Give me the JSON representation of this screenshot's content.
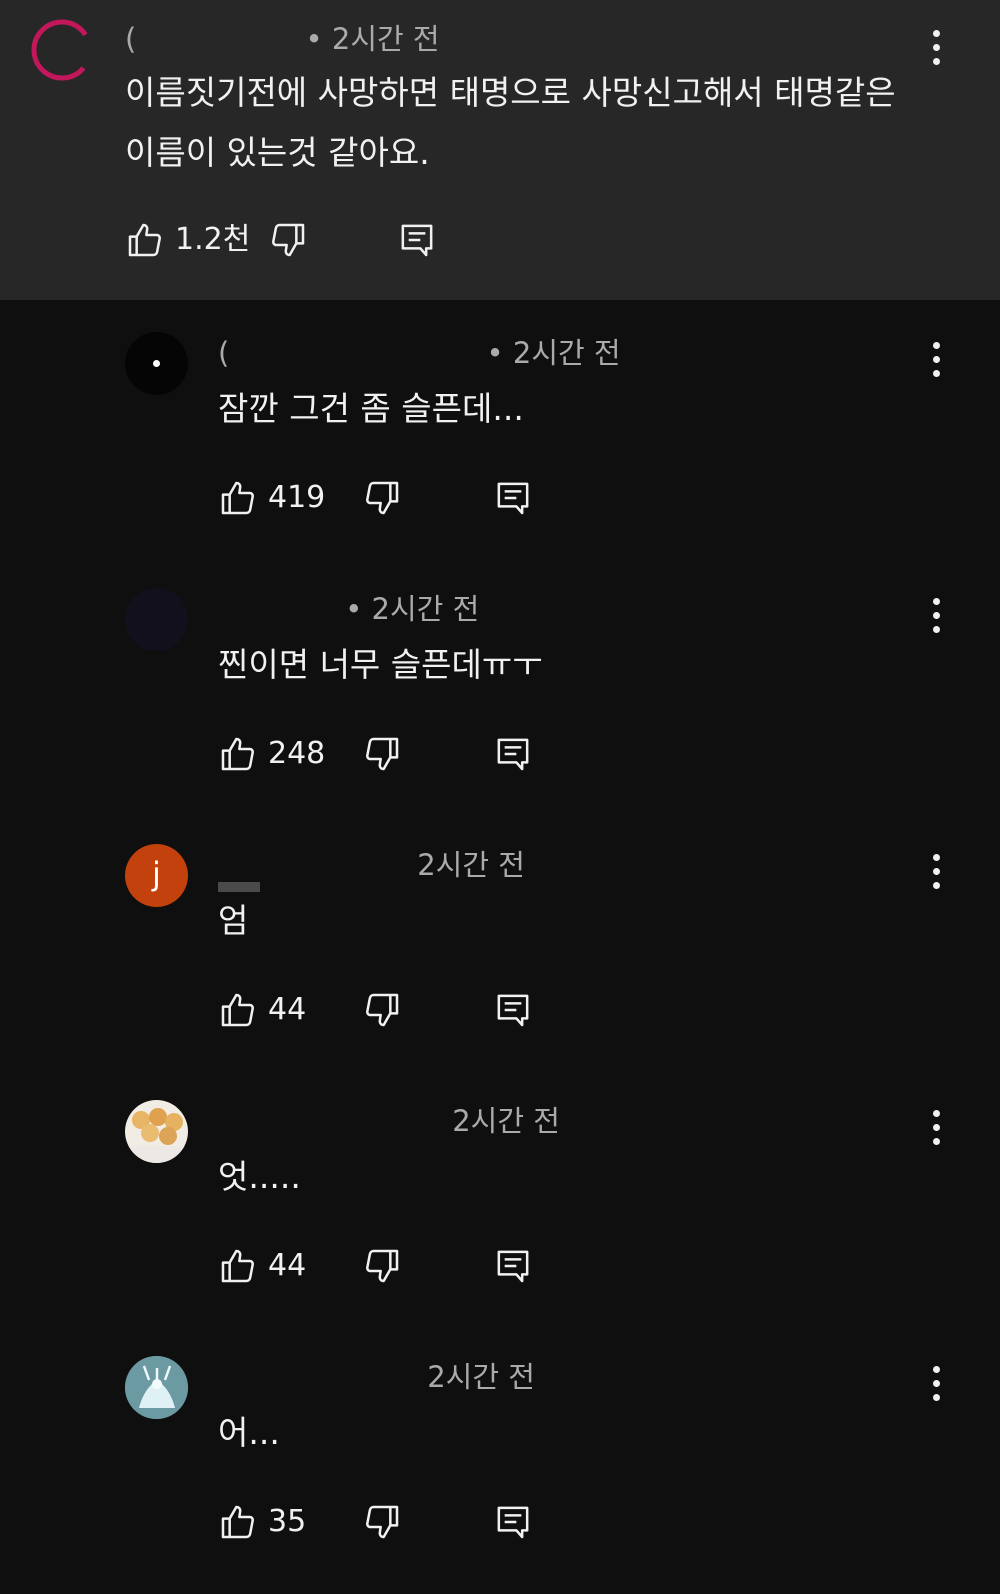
{
  "top_comment": {
    "author_initial": "(",
    "time": "• 2시간 전",
    "text": "이름짓기전에 사망하면 태명으로 사망신고해서 태명같은 이름이 있는것 같아요.",
    "likes": "1.2천"
  },
  "replies": [
    {
      "author_initial": "(",
      "time": "• 2시간 전",
      "text": "잠깐 그건 좀 슬픈데...",
      "likes": "419"
    },
    {
      "author_initial": "",
      "time": "• 2시간 전",
      "text": "찐이면 너무 슬픈데ㅠㅜ",
      "likes": "248"
    },
    {
      "avatar_letter": "j",
      "time": "2시간 전",
      "text": "엄",
      "likes": "44"
    },
    {
      "time": "2시간 전",
      "text": "엇.....",
      "likes": "44"
    },
    {
      "time": "2시간 전",
      "text": "어...",
      "likes": "35"
    }
  ],
  "colors": {
    "background": "#0f0f0f",
    "highlight": "#272727",
    "text": "#f1f1f1",
    "meta": "#aaaaaa",
    "avatar_j": "#c2410c"
  },
  "icons": [
    "thumb-up-icon",
    "thumb-down-icon",
    "reply-icon",
    "more-vert-icon"
  ]
}
